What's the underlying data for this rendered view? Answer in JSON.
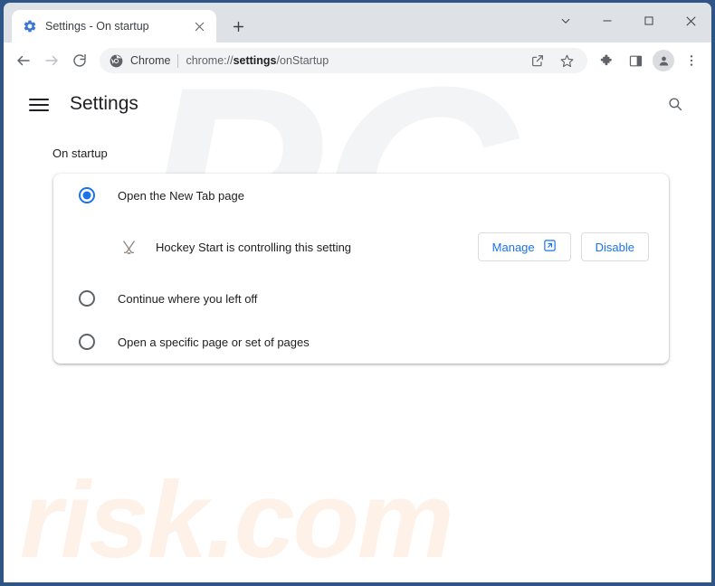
{
  "window": {
    "frame_color": "#2f5486",
    "controls": [
      {
        "name": "tab-search",
        "glyph": "chevron-down"
      },
      {
        "name": "minimize",
        "glyph": "minimize"
      },
      {
        "name": "maximize",
        "glyph": "maximize"
      },
      {
        "name": "close",
        "glyph": "close"
      }
    ]
  },
  "tabstrip": {
    "tab_title": "Settings - On startup",
    "tab_favicon": "gear-icon",
    "close_label": "×",
    "newtab_label": "+"
  },
  "toolbar": {
    "back": "←",
    "forward": "→",
    "reload": "⟳",
    "omnibox": {
      "chip_icon": "chrome-logo-icon",
      "chip_label": "Chrome",
      "url_prefix": "chrome://",
      "url_bold": "settings",
      "url_suffix": "/onStartup"
    },
    "share_icon": "share-icon",
    "bookmark_icon": "star-icon",
    "extensions_icon": "puzzle-icon",
    "sidepanel_icon": "side-panel-icon",
    "profile_icon": "person-icon",
    "menu_icon": "three-dot-menu-icon"
  },
  "page": {
    "menu_button": "hamburger-icon",
    "title": "Settings",
    "search_icon": "search-icon",
    "section_label": "On startup",
    "watermarks": {
      "primary": "PC",
      "secondary": "risk.com"
    },
    "options": [
      {
        "label": "Open the New Tab page",
        "selected": true
      },
      {
        "label": "Continue where you left off",
        "selected": false
      },
      {
        "label": "Open a specific page or set of pages",
        "selected": false
      }
    ],
    "extension_notice": {
      "icon": "hockey-sticks-icon",
      "text": "Hockey Start is controlling this setting",
      "manage_label": "Manage",
      "manage_icon": "external-link-icon",
      "disable_label": "Disable"
    }
  },
  "colors": {
    "accent": "#1a73e8",
    "text_primary": "#202124",
    "text_secondary": "#5f6368",
    "tabstrip_bg": "#dee1e6",
    "omnibox_bg": "#f1f3f4",
    "watermark_pc": "#f3f4f6",
    "watermark_risk": "#fdf1e8"
  }
}
